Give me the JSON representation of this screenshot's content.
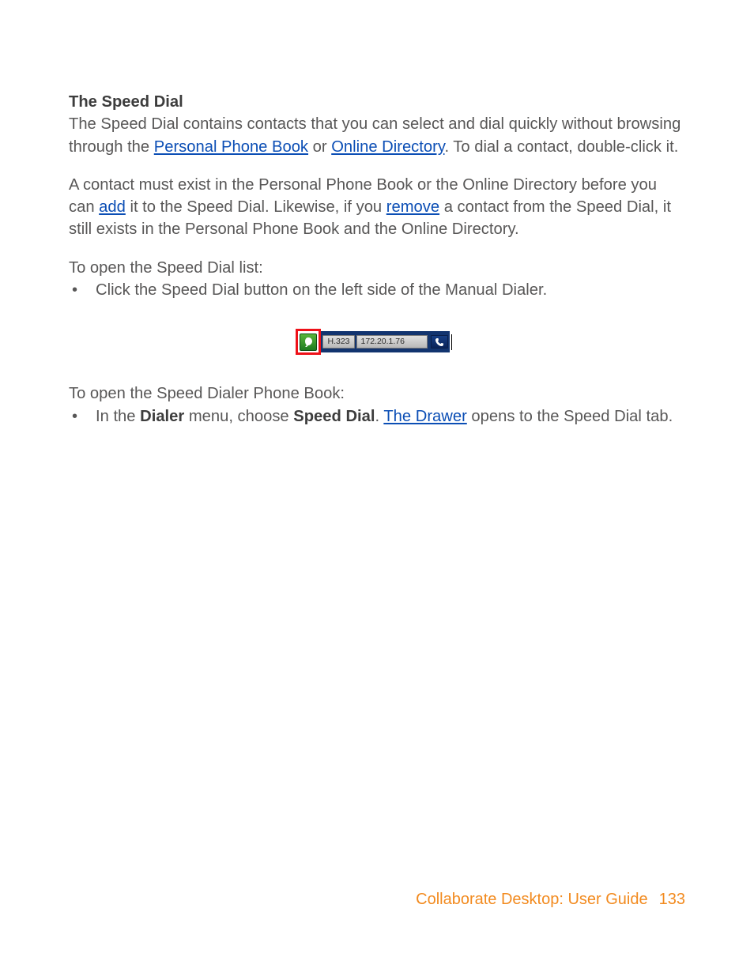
{
  "heading": "The Speed Dial",
  "para1_a": "The Speed Dial contains contacts that you can select and dial quickly without browsing through the ",
  "link_ppb": "Personal Phone Book",
  "para1_b": " or ",
  "link_od": "Online Directory",
  "para1_c": ". To dial a contact, double-click it.",
  "para2_a": "A contact must exist in the Personal Phone Book or the Online Directory before you can ",
  "link_add": "add",
  "para2_b": " it to the Speed Dial. Likewise, if you ",
  "link_remove": "remove",
  "para2_c": " a contact from the Speed Dial, it still exists in the Personal Phone Book and the Online Directory.",
  "para3": "To open the Speed Dial list:",
  "bullet1": "Click the Speed Dial button on the left side of the Manual Dialer.",
  "dialer": {
    "protocol": "H.323",
    "ip": "172.20.1.76"
  },
  "para4": "To open the Speed Dialer Phone Book:",
  "bullet2_a": "In the ",
  "bullet2_bold1": "Dialer",
  "bullet2_b": " menu, choose ",
  "bullet2_bold2": "Speed Dial",
  "bullet2_c": ". ",
  "link_drawer": "The Drawer",
  "bullet2_d": " opens to the Speed Dial tab.",
  "footer": {
    "title": "Collaborate Desktop: User Guide",
    "page": "133"
  }
}
